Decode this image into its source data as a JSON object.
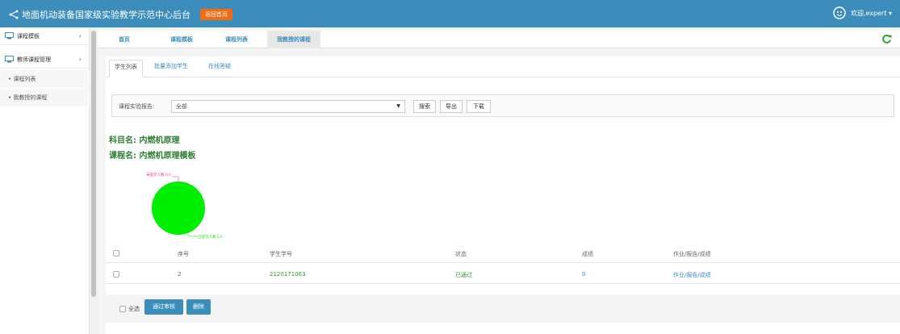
{
  "header": {
    "title": "地面机动装备国家级实验教学示范中心后台",
    "badge": "返回首页",
    "user": "欢迎,expert ▾",
    "brand_color": "#3c8dbc",
    "badge_color": "#f36a10"
  },
  "sidebar": {
    "items": [
      {
        "label": "课程模板",
        "icon": "monitor-icon",
        "chevron": "›"
      },
      {
        "label": "教师课程管理",
        "icon": "monitor-icon",
        "chevron": "›"
      }
    ],
    "subitems": [
      {
        "label": "• 课程列表"
      },
      {
        "label": "• 我教授的课程"
      }
    ]
  },
  "tabs": [
    {
      "label": "首页"
    },
    {
      "label": "课程模板"
    },
    {
      "label": "课程列表"
    },
    {
      "label": "我教授的课程"
    }
  ],
  "subtabs": [
    {
      "label": "学生列表"
    },
    {
      "label": "批量添加学生"
    },
    {
      "label": "在线答疑"
    }
  ],
  "filter": {
    "label": "课程实验报告:",
    "selected": "全部",
    "search_label": "搜索",
    "export_label": "导出",
    "download_label": "下载"
  },
  "info": {
    "subject": "科目名: 内燃机原理",
    "course": "课程名: 内燃机原理模板"
  },
  "chart_data": {
    "type": "pie",
    "slices": [
      {
        "label": "未提交人数 0人",
        "value": 0,
        "color": "#ff3366"
      },
      {
        "label": "已提交人数 1人",
        "value": 1,
        "color": "#00ee00"
      }
    ]
  },
  "table": {
    "headers": [
      "序号",
      "学生学号",
      "状态",
      "成绩",
      "作业/报告/成绩"
    ],
    "rows": [
      {
        "index": "2",
        "student_id": "2120171063",
        "status": "已通过",
        "score": "0",
        "action": "作业/报告/成绩"
      }
    ]
  },
  "footer": {
    "select_all": "全选",
    "approve_label": "通过审核",
    "delete_label": "删除"
  }
}
